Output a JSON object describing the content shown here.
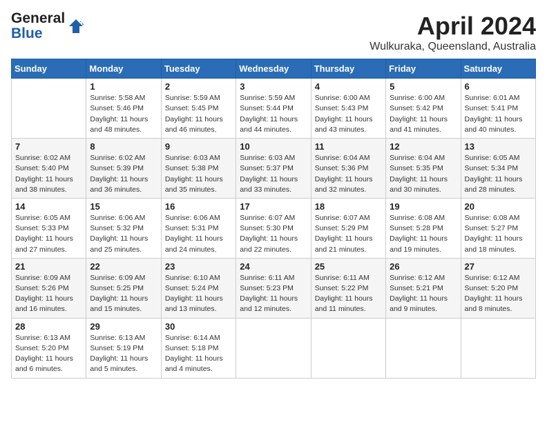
{
  "logo": {
    "line1": "General",
    "line2": "Blue"
  },
  "title": "April 2024",
  "location": "Wulkuraka, Queensland, Australia",
  "days_of_week": [
    "Sunday",
    "Monday",
    "Tuesday",
    "Wednesday",
    "Thursday",
    "Friday",
    "Saturday"
  ],
  "weeks": [
    [
      {
        "num": "",
        "info": ""
      },
      {
        "num": "1",
        "info": "Sunrise: 5:58 AM\nSunset: 5:46 PM\nDaylight: 11 hours\nand 48 minutes."
      },
      {
        "num": "2",
        "info": "Sunrise: 5:59 AM\nSunset: 5:45 PM\nDaylight: 11 hours\nand 46 minutes."
      },
      {
        "num": "3",
        "info": "Sunrise: 5:59 AM\nSunset: 5:44 PM\nDaylight: 11 hours\nand 44 minutes."
      },
      {
        "num": "4",
        "info": "Sunrise: 6:00 AM\nSunset: 5:43 PM\nDaylight: 11 hours\nand 43 minutes."
      },
      {
        "num": "5",
        "info": "Sunrise: 6:00 AM\nSunset: 5:42 PM\nDaylight: 11 hours\nand 41 minutes."
      },
      {
        "num": "6",
        "info": "Sunrise: 6:01 AM\nSunset: 5:41 PM\nDaylight: 11 hours\nand 40 minutes."
      }
    ],
    [
      {
        "num": "7",
        "info": "Sunrise: 6:02 AM\nSunset: 5:40 PM\nDaylight: 11 hours\nand 38 minutes."
      },
      {
        "num": "8",
        "info": "Sunrise: 6:02 AM\nSunset: 5:39 PM\nDaylight: 11 hours\nand 36 minutes."
      },
      {
        "num": "9",
        "info": "Sunrise: 6:03 AM\nSunset: 5:38 PM\nDaylight: 11 hours\nand 35 minutes."
      },
      {
        "num": "10",
        "info": "Sunrise: 6:03 AM\nSunset: 5:37 PM\nDaylight: 11 hours\nand 33 minutes."
      },
      {
        "num": "11",
        "info": "Sunrise: 6:04 AM\nSunset: 5:36 PM\nDaylight: 11 hours\nand 32 minutes."
      },
      {
        "num": "12",
        "info": "Sunrise: 6:04 AM\nSunset: 5:35 PM\nDaylight: 11 hours\nand 30 minutes."
      },
      {
        "num": "13",
        "info": "Sunrise: 6:05 AM\nSunset: 5:34 PM\nDaylight: 11 hours\nand 28 minutes."
      }
    ],
    [
      {
        "num": "14",
        "info": "Sunrise: 6:05 AM\nSunset: 5:33 PM\nDaylight: 11 hours\nand 27 minutes."
      },
      {
        "num": "15",
        "info": "Sunrise: 6:06 AM\nSunset: 5:32 PM\nDaylight: 11 hours\nand 25 minutes."
      },
      {
        "num": "16",
        "info": "Sunrise: 6:06 AM\nSunset: 5:31 PM\nDaylight: 11 hours\nand 24 minutes."
      },
      {
        "num": "17",
        "info": "Sunrise: 6:07 AM\nSunset: 5:30 PM\nDaylight: 11 hours\nand 22 minutes."
      },
      {
        "num": "18",
        "info": "Sunrise: 6:07 AM\nSunset: 5:29 PM\nDaylight: 11 hours\nand 21 minutes."
      },
      {
        "num": "19",
        "info": "Sunrise: 6:08 AM\nSunset: 5:28 PM\nDaylight: 11 hours\nand 19 minutes."
      },
      {
        "num": "20",
        "info": "Sunrise: 6:08 AM\nSunset: 5:27 PM\nDaylight: 11 hours\nand 18 minutes."
      }
    ],
    [
      {
        "num": "21",
        "info": "Sunrise: 6:09 AM\nSunset: 5:26 PM\nDaylight: 11 hours\nand 16 minutes."
      },
      {
        "num": "22",
        "info": "Sunrise: 6:09 AM\nSunset: 5:25 PM\nDaylight: 11 hours\nand 15 minutes."
      },
      {
        "num": "23",
        "info": "Sunrise: 6:10 AM\nSunset: 5:24 PM\nDaylight: 11 hours\nand 13 minutes."
      },
      {
        "num": "24",
        "info": "Sunrise: 6:11 AM\nSunset: 5:23 PM\nDaylight: 11 hours\nand 12 minutes."
      },
      {
        "num": "25",
        "info": "Sunrise: 6:11 AM\nSunset: 5:22 PM\nDaylight: 11 hours\nand 11 minutes."
      },
      {
        "num": "26",
        "info": "Sunrise: 6:12 AM\nSunset: 5:21 PM\nDaylight: 11 hours\nand 9 minutes."
      },
      {
        "num": "27",
        "info": "Sunrise: 6:12 AM\nSunset: 5:20 PM\nDaylight: 11 hours\nand 8 minutes."
      }
    ],
    [
      {
        "num": "28",
        "info": "Sunrise: 6:13 AM\nSunset: 5:20 PM\nDaylight: 11 hours\nand 6 minutes."
      },
      {
        "num": "29",
        "info": "Sunrise: 6:13 AM\nSunset: 5:19 PM\nDaylight: 11 hours\nand 5 minutes."
      },
      {
        "num": "30",
        "info": "Sunrise: 6:14 AM\nSunset: 5:18 PM\nDaylight: 11 hours\nand 4 minutes."
      },
      {
        "num": "",
        "info": ""
      },
      {
        "num": "",
        "info": ""
      },
      {
        "num": "",
        "info": ""
      },
      {
        "num": "",
        "info": ""
      }
    ]
  ]
}
